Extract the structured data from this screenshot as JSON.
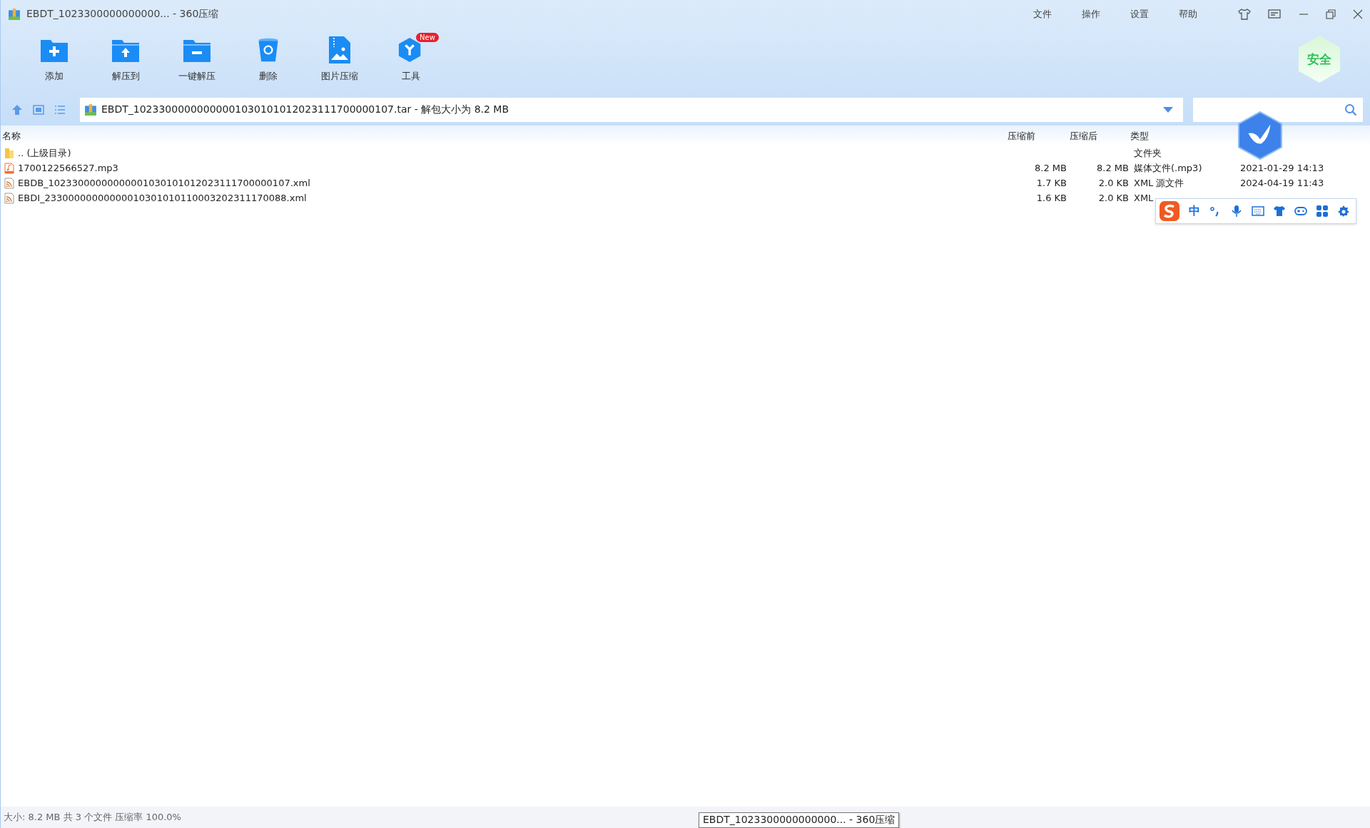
{
  "window": {
    "title": "EBDT_1023300000000000... - 360压缩"
  },
  "menu": [
    "文件",
    "操作",
    "设置",
    "帮助"
  ],
  "toolbar": [
    {
      "label": "添加",
      "kind": "add"
    },
    {
      "label": "解压到",
      "kind": "extract"
    },
    {
      "label": "一键解压",
      "kind": "oneclick"
    },
    {
      "label": "删除",
      "kind": "delete"
    },
    {
      "label": "图片压缩",
      "kind": "image"
    },
    {
      "label": "工具",
      "kind": "tools",
      "badge": "New"
    }
  ],
  "security_badge": "安全",
  "address": {
    "value": "EBDT_10233000000000001030101012023111700000107.tar - 解包大小为 8.2 MB"
  },
  "table": {
    "columns": [
      "名称",
      "压缩前",
      "压缩后",
      "类型"
    ],
    "rows": [
      {
        "kind": "folder",
        "name": ".. (上级目录)",
        "before": "",
        "after": "",
        "type": "文件夹",
        "date": ""
      },
      {
        "kind": "audio",
        "name": "1700122566527.mp3",
        "before": "8.2 MB",
        "after": "8.2 MB",
        "type": "媒体文件(.mp3)",
        "date": "2021-01-29 14:13"
      },
      {
        "kind": "xml",
        "name": "EBDB_10233000000000001030101012023111700000107.xml",
        "before": "1.7 KB",
        "after": "2.0 KB",
        "type": "XML 源文件",
        "date": "2024-04-19 11:43"
      },
      {
        "kind": "xml",
        "name": "EBDI_23300000000000010301010110003202311170088.xml",
        "before": "1.6 KB",
        "after": "2.0 KB",
        "type": "XML",
        "date": ""
      }
    ]
  },
  "ime_bar": {
    "label": "中"
  },
  "status_bar": "大小: 8.2 MB 共 3 个文件 压缩率 100.0%",
  "tooltip": "EBDT_1023300000000000... - 360压缩"
}
